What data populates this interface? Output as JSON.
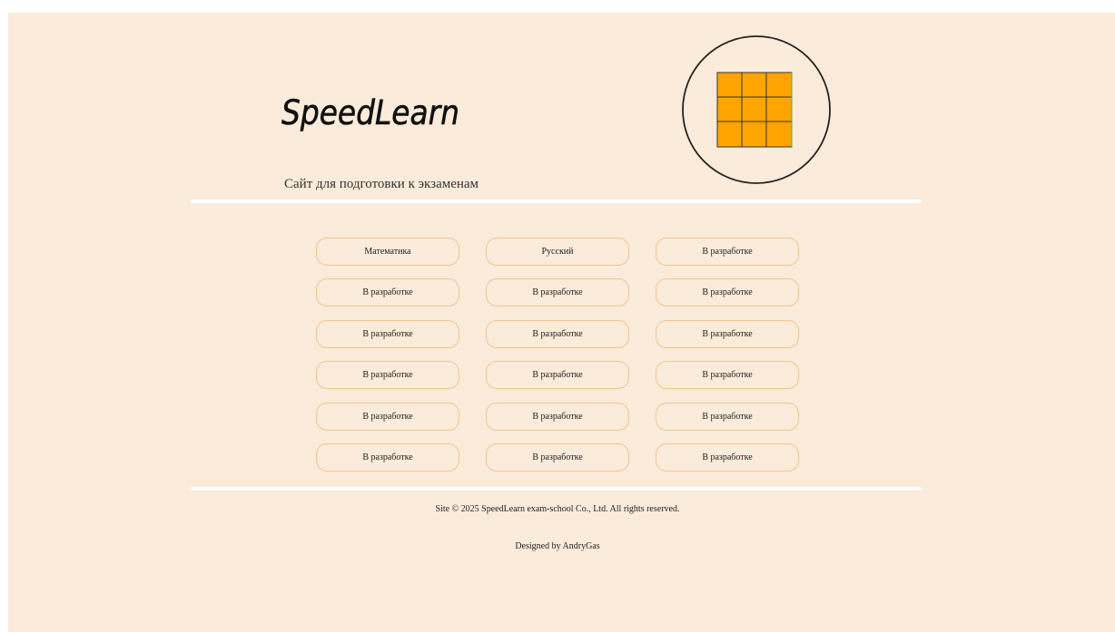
{
  "header": {
    "brand": "SpeedLearn",
    "subtitle": "Сайт для подготовки к экзаменам"
  },
  "emblem": {
    "icon": "cube-grid-icon",
    "fill_color": "#ffa500",
    "line_color": "#333333"
  },
  "subjects": [
    {
      "label": "Математика"
    },
    {
      "label": "Русский"
    },
    {
      "label": "В разработке"
    },
    {
      "label": "В разработке"
    },
    {
      "label": "В разработке"
    },
    {
      "label": "В разработке"
    },
    {
      "label": "В разработке"
    },
    {
      "label": "В разработке"
    },
    {
      "label": "В разработке"
    },
    {
      "label": "В разработке"
    },
    {
      "label": "В разработке"
    },
    {
      "label": "В разработке"
    },
    {
      "label": "В разработке"
    },
    {
      "label": "В разработке"
    },
    {
      "label": "В разработке"
    },
    {
      "label": "В разработке"
    },
    {
      "label": "В разработке"
    },
    {
      "label": "В разработке"
    }
  ],
  "footer": {
    "copyright": "Site © 2025 SpeedLearn exam-school Co., Ltd. All rights reserved.",
    "designer": "Designed by AndryGas"
  },
  "colors": {
    "page_background": "#fbebda",
    "button_border": "#f2c492",
    "divider": "#ffffff"
  }
}
